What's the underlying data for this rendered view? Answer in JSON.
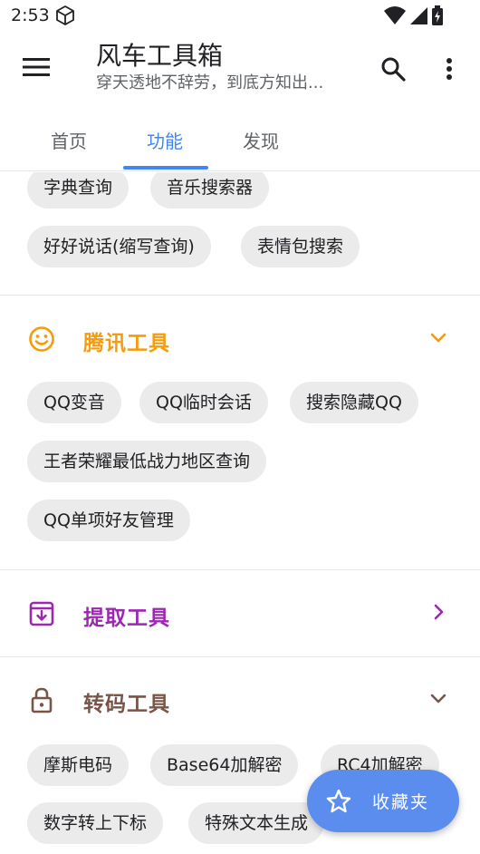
{
  "status_bar": {
    "time": "2:53"
  },
  "app_bar": {
    "title": "风车工具箱",
    "subtitle": "穿天透地不辞劳，到底方知出..."
  },
  "tabs": [
    {
      "label": "首页"
    },
    {
      "label": "功能"
    },
    {
      "label": "发现"
    }
  ],
  "active_tab": "功能",
  "top_chips": [
    "字典查询",
    "音乐搜索器",
    "好好说话(缩写查询)",
    "表情包搜索"
  ],
  "categories": [
    {
      "title": "腾讯工具",
      "icon": "smiley-icon",
      "color": "#f59b0c",
      "expanded": true,
      "chips": [
        "QQ变音",
        "QQ临时会话",
        "搜索隐藏QQ",
        "王者荣耀最低战力地区查询",
        "QQ单项好友管理"
      ]
    },
    {
      "title": "提取工具",
      "icon": "archive-box-icon",
      "color": "#9c27b0",
      "expanded": false,
      "chips": []
    },
    {
      "title": "转码工具",
      "icon": "lock-icon",
      "color": "#795548",
      "expanded": true,
      "chips": [
        "摩斯电码",
        "Base64加解密",
        "RC4加解密",
        "数字转上下标",
        "特殊文本生成"
      ]
    }
  ],
  "fab": {
    "label": "收藏夹",
    "icon": "star-outline-icon",
    "color": "#5b8def"
  }
}
